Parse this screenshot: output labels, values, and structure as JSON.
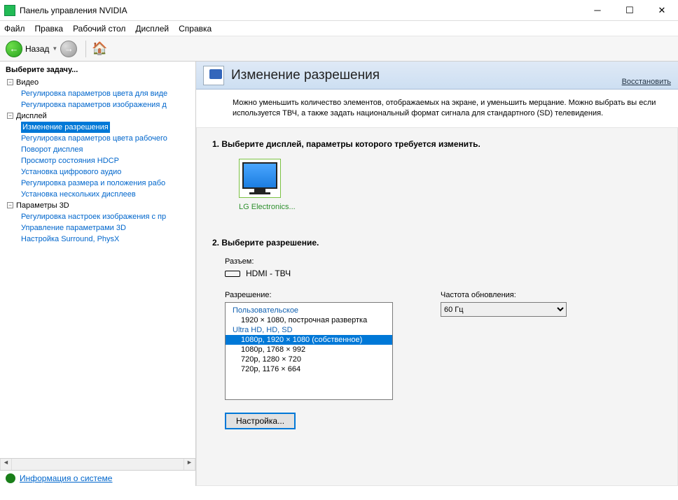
{
  "titlebar": {
    "title": "Панель управления NVIDIA"
  },
  "menu": {
    "file": "Файл",
    "edit": "Правка",
    "desktop": "Рабочий стол",
    "display": "Дисплей",
    "help": "Справка"
  },
  "toolbar": {
    "back": "Назад"
  },
  "sidebar": {
    "header": "Выберите задачу...",
    "groups": [
      {
        "label": "Видео",
        "items": [
          "Регулировка параметров цвета для виде",
          "Регулировка параметров изображения д"
        ]
      },
      {
        "label": "Дисплей",
        "items": [
          "Изменение разрешения",
          "Регулировка параметров цвета рабочего",
          "Поворот дисплея",
          "Просмотр состояния HDCP",
          "Установка цифрового аудио",
          "Регулировка размера и положения рабо",
          "Установка нескольких дисплеев"
        ],
        "selected": 0
      },
      {
        "label": "Параметры 3D",
        "items": [
          "Регулировка настроек изображения с пр",
          "Управление параметрами 3D",
          "Настройка Surround, PhysX"
        ]
      }
    ],
    "sysinfo": "Информация о системе"
  },
  "main": {
    "title": "Изменение разрешения",
    "restore": "Восстановить",
    "description": "Можно уменьшить количество элементов, отображаемых на экране, и уменьшить мерцание. Можно выбрать вы если используется ТВЧ, а также задать национальный формат сигнала для стандартного (SD) телевидения.",
    "step1": "1. Выберите дисплей, параметры которого требуется изменить.",
    "monitor_label": "LG Electronics...",
    "step2": "2. Выберите разрешение.",
    "connector_label": "Разъем:",
    "connector_value": "HDMI - ТВЧ",
    "resolution_label": "Разрешение:",
    "refresh_label": "Частота обновления:",
    "refresh_value": "60 Гц",
    "res_groups": [
      {
        "cat": "Пользовательское",
        "opts": [
          "1920 × 1080, построчная развертка"
        ]
      },
      {
        "cat": "Ultra HD, HD, SD",
        "opts": [
          "1080p, 1920 × 1080 (собственное)",
          "1080p, 1768 × 992",
          "720p, 1280 × 720",
          "720p, 1176 × 664"
        ],
        "selected": 0
      }
    ],
    "settings_btn": "Настройка..."
  }
}
